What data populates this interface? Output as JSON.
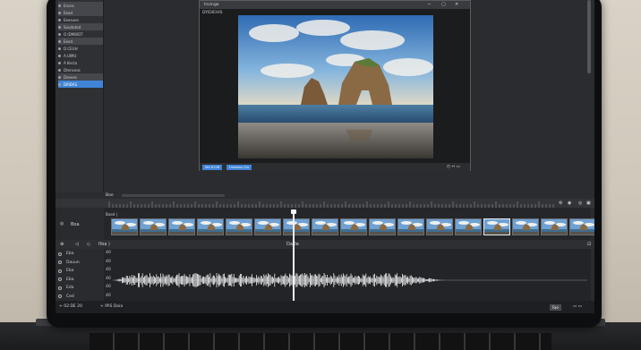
{
  "left_panel": {
    "items": [
      {
        "label": "Ences",
        "style": "dark"
      },
      {
        "label": "Eead",
        "style": "dark"
      },
      {
        "label": "Eeesuen",
        "style": "plain"
      },
      {
        "label": "Soudutod",
        "style": "dark"
      },
      {
        "label": "O IDMWDT",
        "style": "plain"
      },
      {
        "label": "Eeed",
        "style": "dark"
      },
      {
        "label": "D.CEUH",
        "style": "plain"
      },
      {
        "label": "A.UIMU",
        "style": "plain"
      },
      {
        "label": "A Kecta",
        "style": "plain"
      },
      {
        "label": "Dtenseas",
        "style": "plain"
      },
      {
        "label": "Deeees",
        "style": "dark"
      },
      {
        "label": "DIRBAS",
        "style": "selected"
      }
    ]
  },
  "viewer": {
    "title": "Invinge",
    "subtitle": "DYIDIEHIS",
    "bottom_left_btn": "Vel 02:M",
    "bottom_mid_btn": "Uiveanu Gu",
    "bottom_right": "◷ ↔ ▭"
  },
  "timeline": {
    "toolbar_label": "Boe",
    "clip_track_name": "Boa",
    "clip_label": "Boed  |",
    "audio_ruler_left": "Ifoa  ⟩",
    "audio_ruler_mid": "DaDe",
    "audio_tracks": [
      {
        "name": "Eba",
        "num": "40"
      },
      {
        "name": "Dauun",
        "num": "40"
      },
      {
        "name": "Eba",
        "num": "40"
      },
      {
        "name": "Eba",
        "num": "40"
      },
      {
        "name": "Eda",
        "num": "40"
      },
      {
        "name": "Ced",
        "num": "40"
      }
    ]
  },
  "statusbar": {
    "left_text": "+  02:DE 20",
    "mid_text": "+ IPIS   Doia",
    "btn_label": "Fae"
  }
}
